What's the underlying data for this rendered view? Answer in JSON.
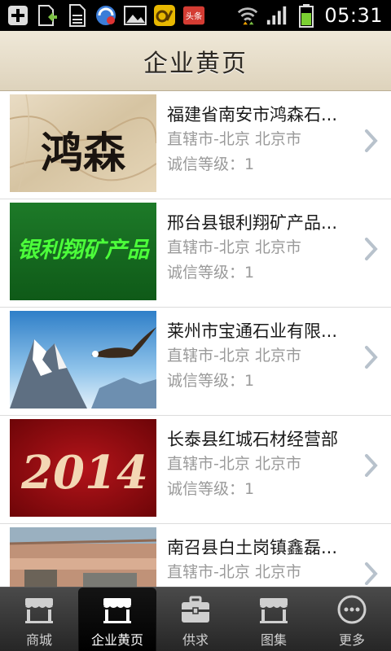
{
  "status_bar": {
    "time": "05:31",
    "left_icons": [
      "add-icon",
      "sim-download-icon",
      "sd-card-icon",
      "shield-app-icon",
      "image-icon",
      "snail-app-icon",
      "toutiao-app-icon"
    ],
    "toutiao_label": "头条",
    "right_icons": [
      "wifi-icon",
      "signal-icon",
      "battery-icon"
    ]
  },
  "header": {
    "title": "企业黄页"
  },
  "companies": [
    {
      "name": "福建省南安市鸿森石...",
      "location": "直辖市-北京 北京市",
      "credit": "诚信等级：1",
      "thumb": "鸿森"
    },
    {
      "name": "邢台县银利翔矿产品...",
      "location": "直辖市-北京 北京市",
      "credit": "诚信等级：1",
      "thumb": "银利翔矿产品"
    },
    {
      "name": "莱州市宝通石业有限...",
      "location": "直辖市-北京 北京市",
      "credit": "诚信等级：1",
      "thumb": ""
    },
    {
      "name": "长泰县红城石材经营部",
      "location": "直辖市-北京 北京市",
      "credit": "诚信等级：1",
      "thumb": "2014"
    },
    {
      "name": "南召县白土岗镇鑫磊...",
      "location": "直辖市-北京 北京市",
      "credit": "",
      "thumb": ""
    }
  ],
  "bottom_nav": [
    {
      "label": "商城",
      "icon": "storefront-icon",
      "active": false
    },
    {
      "label": "企业黄页",
      "icon": "storefront-icon",
      "active": true
    },
    {
      "label": "供求",
      "icon": "briefcase-icon",
      "active": false
    },
    {
      "label": "图集",
      "icon": "storefront-icon",
      "active": false
    },
    {
      "label": "更多",
      "icon": "more-icon",
      "active": false
    }
  ],
  "colors": {
    "title_bar": "#e6dcc8",
    "nav_bg": "#333333",
    "text_primary": "#1a1a1a",
    "text_secondary": "#9a9a9a",
    "chevron": "#b8c2cc"
  }
}
